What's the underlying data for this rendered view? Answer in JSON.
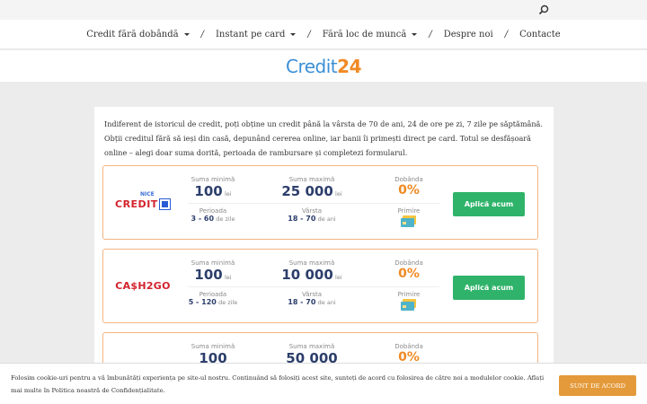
{
  "header": {
    "search_icon": "search-icon",
    "nav": [
      {
        "label": "Credit fără dobândă",
        "has_dropdown": true
      },
      {
        "label": "Instant pe card",
        "has_dropdown": true
      },
      {
        "label": "Fără loc de muncă",
        "has_dropdown": true
      },
      {
        "label": "Despre noi",
        "has_dropdown": false
      },
      {
        "label": "Contacte",
        "has_dropdown": false
      }
    ],
    "separator": "/",
    "logo_text_a": "Credit",
    "logo_text_b": "24"
  },
  "intro": "Indiferent de istoricul de credit, poți obține un credit până la vârsta de 70 de ani, 24 de ore pe zi, 7 zile pe săptămână. Obții creditul fără să ieși din casă, depunând cererea online, iar banii îi primești direct pe card. Totul se desfășoară online – alegi doar suma dorită, perioada de rambursare și completezi formularul.",
  "labels": {
    "min_sum": "Suma minimă",
    "max_sum": "Suma maximă",
    "interest": "Dobânda",
    "period": "Perioada",
    "age": "Vârsta",
    "receive": "Primire",
    "currency": "lei",
    "days": "de zile",
    "years": "de ani",
    "apply": "Aplică acum"
  },
  "offers": [
    {
      "brand_small": "NICE",
      "brand": "CREDIT",
      "min": "100",
      "max": "25 000",
      "rate": "0%",
      "period": "3 - 60",
      "age": "18 - 70"
    },
    {
      "brand": "CA$H2GO",
      "min": "100",
      "max": "10 000",
      "rate": "0%",
      "period": "5 - 120",
      "age": "18 - 70"
    },
    {
      "brand": "",
      "min": "100",
      "max": "50 000",
      "rate": "0%"
    }
  ],
  "cookie": {
    "text": "Folosim cookie-uri pentru a vă îmbunătăți experiența pe site-ul nostru. Continuând să folosiți acest site, sunteți de acord cu folosirea de către noi a modulelor cookie. Aflați mai multe în Politica noastră de Confidențialitate.",
    "accept": "SUNT DE ACORD"
  },
  "colors": {
    "accent": "#f08a24",
    "apply": "#2fb36a",
    "brand_blue": "#3a8fd6",
    "cookie_btn": "#e49a3a"
  }
}
